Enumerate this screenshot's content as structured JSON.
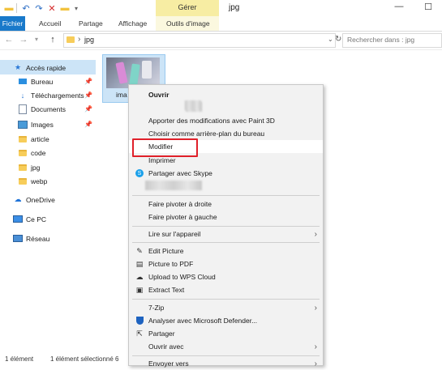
{
  "titlebar": {
    "manage_label": "Gérer",
    "title": "jpg"
  },
  "ribbon": {
    "tabs": [
      "Fichier",
      "Accueil",
      "Partage",
      "Affichage",
      "Outils d'image"
    ]
  },
  "address": {
    "path_sep": "›",
    "path": "jpg",
    "search_placeholder": "Rechercher dans : jpg"
  },
  "sidebar": {
    "items": [
      {
        "label": "Accès rapide",
        "icon": "star-icon"
      },
      {
        "label": "Bureau",
        "icon": "desktop-icon"
      },
      {
        "label": "Téléchargements",
        "icon": "download-icon"
      },
      {
        "label": "Documents",
        "icon": "documents-icon"
      },
      {
        "label": "Images",
        "icon": "images-icon"
      },
      {
        "label": "article",
        "icon": "folder-icon"
      },
      {
        "label": "code",
        "icon": "folder-icon"
      },
      {
        "label": "jpg",
        "icon": "folder-icon"
      },
      {
        "label": "webp",
        "icon": "folder-icon"
      },
      {
        "label": "OneDrive",
        "icon": "cloud-icon"
      },
      {
        "label": "Ce PC",
        "icon": "pc-icon"
      },
      {
        "label": "Réseau",
        "icon": "network-icon"
      }
    ]
  },
  "file": {
    "name_fragment": "ima"
  },
  "context_menu": {
    "items": [
      {
        "label": "Ouvrir"
      },
      {
        "label": "Apporter des modifications avec Paint 3D"
      },
      {
        "label": "Choisir comme arrière-plan du bureau"
      },
      {
        "label": "Modifier"
      },
      {
        "label": "Imprimer"
      },
      {
        "label": "Partager avec Skype"
      },
      {
        "label": "Faire pivoter à droite"
      },
      {
        "label": "Faire pivoter à gauche"
      },
      {
        "label": "Lire sur l'appareil"
      },
      {
        "label": "Edit Picture"
      },
      {
        "label": "Picture to PDF"
      },
      {
        "label": "Upload to WPS Cloud"
      },
      {
        "label": "Extract Text"
      },
      {
        "label": "7-Zip"
      },
      {
        "label": "Analyser avec Microsoft Defender..."
      },
      {
        "label": "Partager"
      },
      {
        "label": "Ouvrir avec"
      },
      {
        "label": "Envoyer vers"
      }
    ]
  },
  "status": {
    "count": "1 élément",
    "selected": "1 élément sélectionné  6"
  },
  "colors": {
    "accent": "#1979ca",
    "manage_band": "#f7eda3",
    "highlight_box": "#e0202a"
  }
}
